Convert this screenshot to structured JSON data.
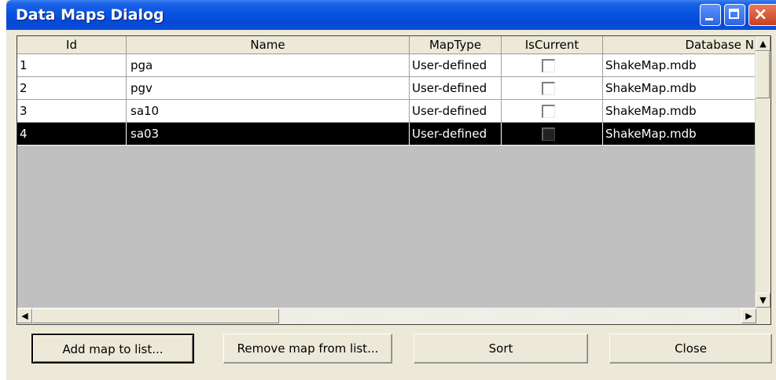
{
  "window": {
    "title": "Data Maps Dialog",
    "buttons": {
      "minimize": "minimize",
      "maximize": "maximize",
      "close": "×"
    }
  },
  "grid": {
    "columns": [
      "Id",
      "Name",
      "MapType",
      "IsCurrent",
      "Database N"
    ],
    "rows": [
      {
        "id": "1",
        "name": "pga",
        "maptype": "User-defined",
        "iscurrent": false,
        "database": "ShakeMap.mdb"
      },
      {
        "id": "2",
        "name": "pgv",
        "maptype": "User-defined",
        "iscurrent": false,
        "database": "ShakeMap.mdb"
      },
      {
        "id": "3",
        "name": "sa10",
        "maptype": "User-defined",
        "iscurrent": false,
        "database": "ShakeMap.mdb"
      },
      {
        "id": "4",
        "name": "sa03",
        "maptype": "User-defined",
        "iscurrent": false,
        "database": "ShakeMap.mdb",
        "selected": true
      }
    ]
  },
  "scrollbar": {
    "up": "▲",
    "down": "▼",
    "left": "◀",
    "right": "▶"
  },
  "buttons": {
    "add": "Add map to list...",
    "remove": "Remove map from list...",
    "sort": "Sort",
    "close": "Close"
  },
  "colors": {
    "titlebar": "#0a56e4",
    "selection": "#000000",
    "grid_background": "#c0c0c0",
    "face": "#ece9d8"
  }
}
